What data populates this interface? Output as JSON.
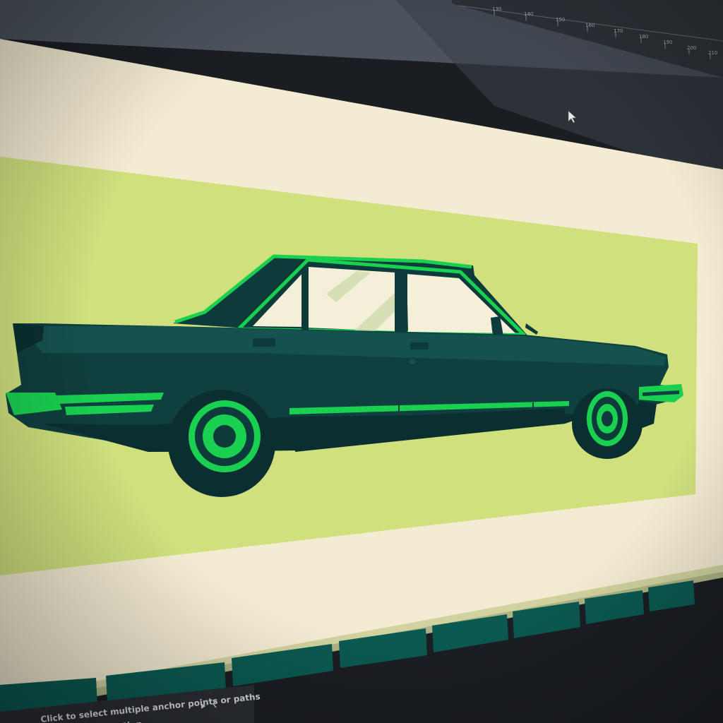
{
  "ruler": {
    "ticks": [
      "130",
      "140",
      "150",
      "160",
      "170",
      "180",
      "190",
      "200",
      "210"
    ]
  },
  "status_bar": {
    "hint_line1": "Click to select multiple anchor points or paths",
    "hint_line2": "tion"
  },
  "artwork": {
    "name": "classic-green-sedan-illustration",
    "colors": {
      "page": "#f4ecd2",
      "background_panel": "#cfe07d",
      "car_body": "#0f3f3e",
      "car_shadow": "#0b2f31",
      "accent_green": "#19d050",
      "window_glass": "#f3efd9",
      "swatch": "#0b5a52"
    }
  },
  "icons": {
    "cursor": "arrow-cursor-icon",
    "play": "play-icon",
    "prev": "chevron-left-icon"
  }
}
